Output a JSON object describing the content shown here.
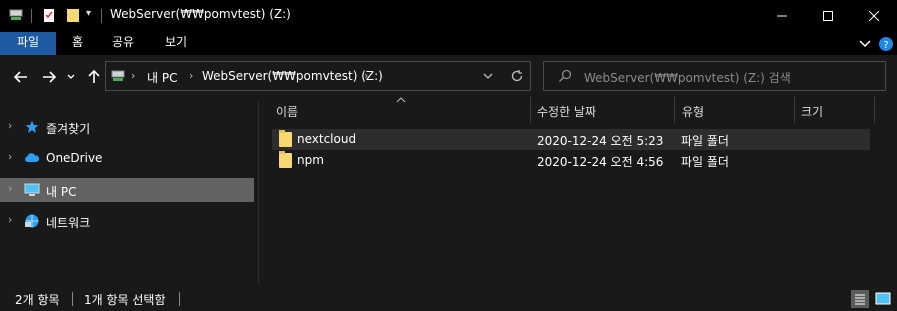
{
  "window": {
    "title": "WebServer(₩₩pomvtest) (Z:)",
    "minimize_icon": "minimize-icon",
    "maximize_icon": "maximize-icon",
    "close_icon": "close-icon"
  },
  "ribbon": {
    "tabs": [
      "파일",
      "홈",
      "공유",
      "보기"
    ],
    "expand_icon": "chevron-down-icon",
    "help_icon": "help-icon"
  },
  "navigation": {
    "address": {
      "crumbs": [
        "내 PC",
        "WebServer(₩₩pomvtest) (Z:)"
      ],
      "drive_icon": "network-drive-icon"
    },
    "search": {
      "placeholder": "WebServer(₩₩pomvtest) (Z:) 검색"
    }
  },
  "sidebar": {
    "items": [
      {
        "label": "즐겨찾기",
        "icon": "star-icon",
        "selected": false
      },
      {
        "label": "OneDrive",
        "icon": "cloud-icon",
        "selected": false
      },
      {
        "label": "내 PC",
        "icon": "computer-icon",
        "selected": true
      },
      {
        "label": "네트워크",
        "icon": "network-icon",
        "selected": false
      }
    ]
  },
  "file_list": {
    "columns": [
      "이름",
      "수정한 날짜",
      "유형",
      "크기"
    ],
    "rows": [
      {
        "name": "nextcloud",
        "date": "2020-12-24 오전 5:23",
        "type": "파일 폴더",
        "size": ""
      },
      {
        "name": "npm",
        "date": "2020-12-24 오전 4:56",
        "type": "파일 폴더",
        "size": ""
      }
    ]
  },
  "status": {
    "item_count": "2개 항목",
    "selected": "1개 항목 선택함"
  },
  "colors": {
    "background": "#191919",
    "titlebar": "#000000",
    "file_tab": "#1d5aa3",
    "selection": "#626262",
    "folder": "#f8d775"
  }
}
